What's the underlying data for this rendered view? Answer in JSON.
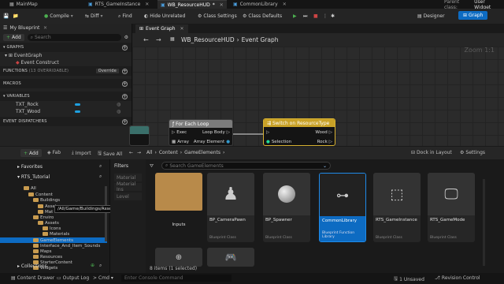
{
  "tabs": [
    "MainMap",
    "RTS_GameInstance",
    "WB_ResourceHUD",
    "CommonLibrary"
  ],
  "parent_class": "Parent class:",
  "parent_class_value": "User Widget",
  "toolbar": {
    "compile": "Compile",
    "diff": "Diff",
    "find": "Find",
    "hide_unrelated": "Hide Unrelated",
    "class_settings": "Class Settings",
    "class_defaults": "Class Defaults",
    "designer": "Designer",
    "graph": "Graph"
  },
  "my_blueprint": {
    "title": "My Blueprint",
    "add": "Add",
    "search_placeholder": "Search",
    "sections": {
      "graphs": "GRAPHS",
      "functions": "FUNCTIONS",
      "functions_count": "(13 OVERRIDABLE)",
      "override": "Override",
      "macros": "MACROS",
      "variables": "VARIABLES",
      "event_dispatchers": "EVENT DISPATCHERS"
    },
    "graph_items": [
      "EventGraph",
      "Event Construct"
    ],
    "variables": [
      "TXT_Rock",
      "TXT_Wood"
    ]
  },
  "graph": {
    "tab": "Event Graph",
    "breadcrumb_root": "WB_ResourceHUD",
    "breadcrumb_leaf": "Event Graph",
    "zoom": "Zoom 1:1",
    "for_each": {
      "title": "For Each Loop",
      "exec": "Exec",
      "loop_body": "Loop Body",
      "array": "Array",
      "array_element": "Array Element"
    },
    "switch_node": {
      "title": "Switch on ResourceType",
      "selection": "Selection",
      "wood": "Wood",
      "rock": "Rock"
    }
  },
  "content_browser": {
    "add": "Add",
    "fab": "Fab",
    "import": "Import",
    "save_all": "Save All",
    "path": [
      "All",
      "Content",
      "GameElements"
    ],
    "dock_in_layout": "Dock in Layout",
    "settings": "Settings",
    "favorites": "Favorites",
    "project": "RTS_Tutorial",
    "search_placeholder": "Search GameElements",
    "filters_title": "Filters",
    "filters": [
      "Material",
      "Material Ins",
      "Level"
    ],
    "tree": [
      {
        "label": "All",
        "indent": 0
      },
      {
        "label": "Content",
        "indent": 1
      },
      {
        "label": "Buildings",
        "indent": 2
      },
      {
        "label": "Assets",
        "indent": 3
      },
      {
        "label": "Mat",
        "indent": 3
      },
      {
        "label": "Enviro",
        "indent": 2
      },
      {
        "label": "Assets",
        "indent": 3
      },
      {
        "label": "Icons",
        "indent": 4
      },
      {
        "label": "Materials",
        "indent": 4
      },
      {
        "label": "GameElements",
        "indent": 2
      },
      {
        "label": "Interface_And_Item_Sounds",
        "indent": 2
      },
      {
        "label": "Maps",
        "indent": 2
      },
      {
        "label": "Resources",
        "indent": 2
      },
      {
        "label": "StarterContent",
        "indent": 2
      },
      {
        "label": "Widgets",
        "indent": 2
      }
    ],
    "tooltip": "/All/Game/Buildings/Assets",
    "collections": "Collections",
    "assets": [
      {
        "name": "Inputs",
        "type": ""
      },
      {
        "name": "BP_CameraPawn",
        "type": "Blueprint Class"
      },
      {
        "name": "BP_Spawner",
        "type": "Blueprint Class"
      },
      {
        "name": "CommonLibrary",
        "type": "Blueprint Function Library"
      },
      {
        "name": "RTS_GameInstance",
        "type": "Blueprint Class"
      },
      {
        "name": "RTS_GameMode",
        "type": "Blueprint Class"
      }
    ],
    "status": "8 items (1 selected)"
  },
  "statusbar": {
    "content_drawer": "Content Drawer",
    "output_log": "Output Log",
    "cmd": "Cmd",
    "console_placeholder": "Enter Console Command",
    "unsaved": "1 Unsaved",
    "revision_control": "Revision Control"
  },
  "colors": {
    "accent_blue": "#0d6bc2",
    "foreach_header": "#7b7b7b",
    "switch_header": "#c9a227",
    "selected_asset": "#0d6bc2",
    "folder": "#c89b4f"
  }
}
